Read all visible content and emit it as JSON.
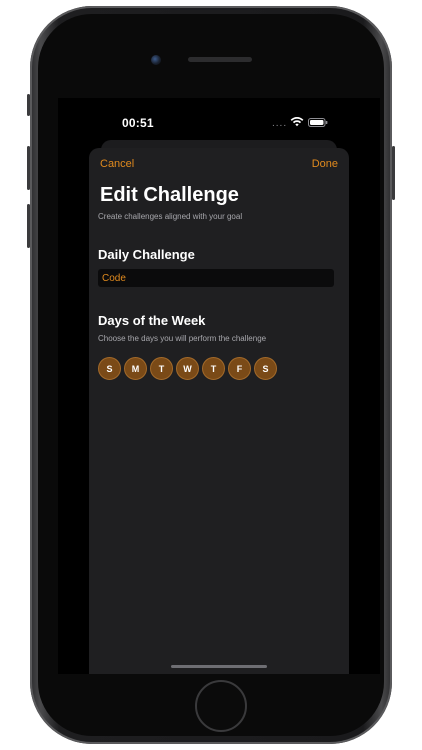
{
  "status_bar": {
    "time": "00:51",
    "signal": "....",
    "wifi_icon": "wifi-icon",
    "battery_icon": "battery-icon"
  },
  "nav": {
    "cancel_label": "Cancel",
    "done_label": "Done"
  },
  "header": {
    "title": "Edit Challenge",
    "subtitle": "Create challenges aligned with your goal"
  },
  "daily_challenge": {
    "title": "Daily Challenge",
    "value": "",
    "placeholder": "Code"
  },
  "days_of_week": {
    "title": "Days of the Week",
    "subtitle": "Choose the days you will perform the challenge",
    "days": [
      "S",
      "M",
      "T",
      "W",
      "T",
      "F",
      "S"
    ]
  },
  "colors": {
    "accent": "#e08a1e",
    "day_fill": "#7a4a17",
    "sheet_bg": "#1f1f21"
  }
}
